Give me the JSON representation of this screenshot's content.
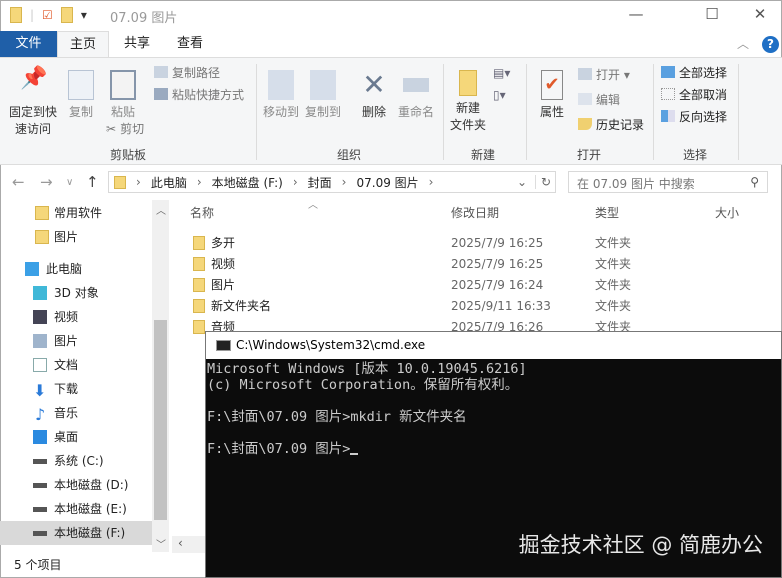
{
  "window": {
    "title": "07.09 图片"
  },
  "tabs": [
    "文件",
    "主页",
    "共享",
    "查看"
  ],
  "ribbon": {
    "clipboard": {
      "pin": "固定到快\n速访问",
      "copy": "复制",
      "paste": "粘贴",
      "copy_path": "复制路径",
      "paste_shortcut": "粘贴快捷方式",
      "cut": "剪切",
      "group": "剪贴板"
    },
    "organize": {
      "move_to": "移动到",
      "copy_to": "复制到",
      "delete": "删除",
      "rename": "重命名",
      "group": "组织"
    },
    "new": {
      "new_folder": "新建\n文件夹",
      "group": "新建"
    },
    "open": {
      "properties": "属性",
      "open": "打开",
      "edit": "编辑",
      "history": "历史记录",
      "group": "打开"
    },
    "select": {
      "select_all": "全部选择",
      "select_none": "全部取消",
      "invert": "反向选择",
      "group": "选择"
    }
  },
  "address": {
    "crumbs": [
      "此电脑",
      "本地磁盘 (F:)",
      "封面",
      "07.09 图片"
    ],
    "search_placeholder": "在 07.09 图片 中搜索"
  },
  "nav": [
    "常用软件",
    "图片",
    "此电脑",
    "3D 对象",
    "视频",
    "图片",
    "文档",
    "下载",
    "音乐",
    "桌面",
    "系统 (C:)",
    "本地磁盘 (D:)",
    "本地磁盘 (E:)",
    "本地磁盘 (F:)"
  ],
  "columns": [
    "名称",
    "修改日期",
    "类型",
    "大小"
  ],
  "files": [
    {
      "name": "多开",
      "date": "2025/7/9 16:25",
      "type": "文件夹"
    },
    {
      "name": "视频",
      "date": "2025/7/9 16:25",
      "type": "文件夹"
    },
    {
      "name": "图片",
      "date": "2025/7/9 16:24",
      "type": "文件夹"
    },
    {
      "name": "新文件夹名",
      "date": "2025/9/11 16:33",
      "type": "文件夹"
    },
    {
      "name": "音频",
      "date": "2025/7/9 16:26",
      "type": "文件夹"
    }
  ],
  "status": "5 个项目",
  "cmd": {
    "title": "C:\\Windows\\System32\\cmd.exe",
    "lines": [
      "Microsoft Windows [版本 10.0.19045.6216]",
      "(c) Microsoft Corporation。保留所有权利。",
      "",
      "F:\\封面\\07.09 图片>mkdir 新文件夹名",
      "",
      "F:\\封面\\07.09 图片>"
    ]
  },
  "watermark": "掘金技术社区 @ 简鹿办公"
}
